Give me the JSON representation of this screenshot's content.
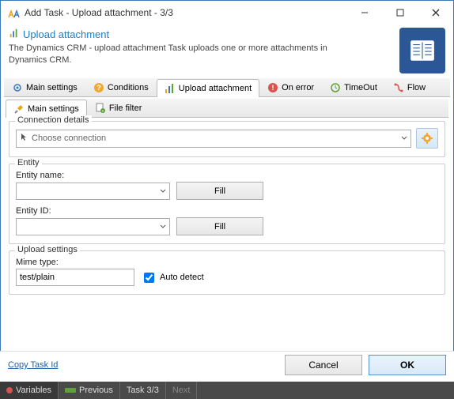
{
  "window": {
    "title": "Add Task - Upload attachment - 3/3"
  },
  "header": {
    "title": "Upload attachment",
    "desc": "The Dynamics CRM - upload attachment Task uploads one or more attachments in Dynamics CRM."
  },
  "tabs": {
    "main": "Main settings",
    "conditions": "Conditions",
    "upload": "Upload attachment",
    "onerror": "On error",
    "timeout": "TimeOut",
    "flow": "Flow"
  },
  "subtabs": {
    "main": "Main settings",
    "filefilter": "File filter"
  },
  "conn": {
    "legend": "Connection details",
    "placeholder": "Choose connection"
  },
  "entity": {
    "legend": "Entity",
    "name_label": "Entity name:",
    "id_label": "Entity ID:",
    "fill": "Fill"
  },
  "upload": {
    "legend": "Upload settings",
    "mime_label": "Mime type:",
    "mime_value": "test/plain",
    "autodetect": "Auto detect"
  },
  "footer": {
    "copy": "Copy Task Id",
    "cancel": "Cancel",
    "ok": "OK"
  },
  "status": {
    "variables": "Variables",
    "previous": "Previous",
    "task": "Task 3/3",
    "next": "Next"
  }
}
